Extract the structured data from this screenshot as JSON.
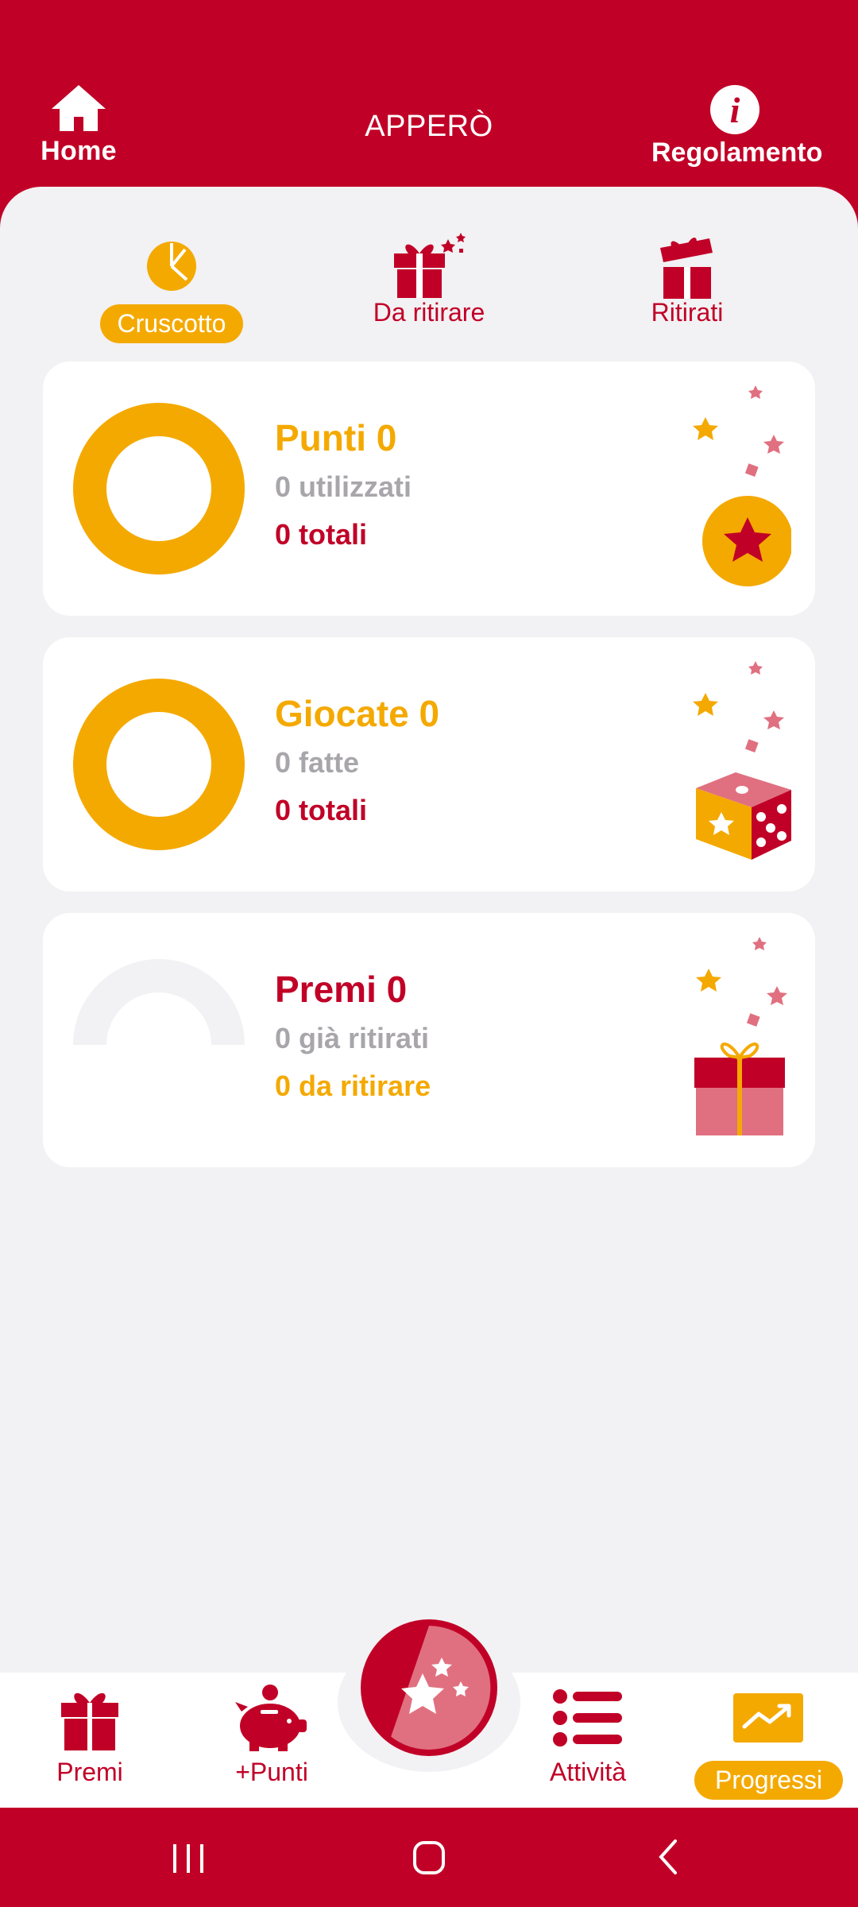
{
  "header": {
    "home_label": "Home",
    "title": "APPERÒ",
    "rules_label": "Regolamento",
    "rules_icon": "info-icon",
    "home_icon": "home-icon"
  },
  "tabs": [
    {
      "label": "Cruscotto",
      "icon": "pie-chart-icon",
      "active": true
    },
    {
      "label": "Da ritirare",
      "icon": "gift-sparkle-icon",
      "active": false
    },
    {
      "label": "Ritirati",
      "icon": "open-gift-icon",
      "active": false
    }
  ],
  "cards": {
    "points": {
      "title": "Punti 0",
      "used": "0 utilizzati",
      "total": "0 totali",
      "icon": "star-badge-icon"
    },
    "plays": {
      "title": "Giocate 0",
      "done": "0 fatte",
      "total": "0 totali",
      "icon": "dice-icon"
    },
    "prizes": {
      "title": "Premi 0",
      "collected": "0 già ritirati",
      "pending": "0 da ritirare",
      "icon": "gift-box-icon"
    }
  },
  "bottom_nav": [
    {
      "label": "Premi",
      "icon": "gift-icon"
    },
    {
      "label": "+Punti",
      "icon": "piggy-bank-icon"
    },
    {
      "label": "",
      "icon": "stars-center-icon"
    },
    {
      "label": "Attività",
      "icon": "list-icon"
    },
    {
      "label": "Progressi",
      "icon": "trend-chart-icon",
      "active": true
    }
  ],
  "colors": {
    "brand_red": "#c10027",
    "accent_gold": "#f4a900",
    "panel_bg": "#f2f1f3",
    "muted_gray": "#a8a6aa"
  }
}
